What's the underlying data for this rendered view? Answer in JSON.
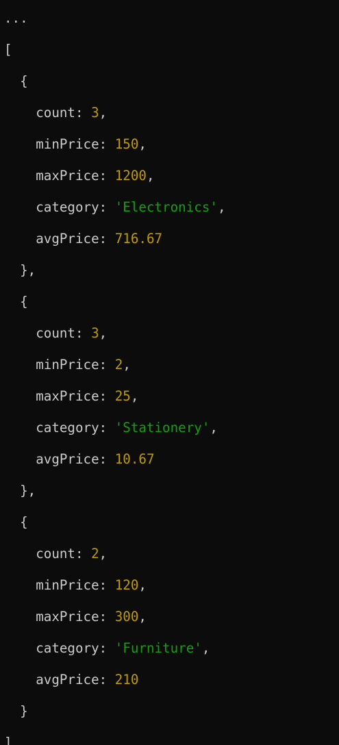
{
  "terminal": {
    "ellipsis": "...",
    "open_bracket": "[",
    "close_bracket": "]"
  },
  "records": [
    {
      "count": "3",
      "minPrice": "150",
      "maxPrice": "1200",
      "category": "'Electronics'",
      "avgPrice": "716.67"
    },
    {
      "count": "3",
      "minPrice": "2",
      "maxPrice": "25",
      "category": "'Stationery'",
      "avgPrice": "10.67"
    },
    {
      "count": "2",
      "minPrice": "120",
      "maxPrice": "300",
      "category": "'Furniture'",
      "avgPrice": "210"
    }
  ],
  "labels": {
    "count": "count",
    "minPrice": "minPrice",
    "maxPrice": "maxPrice",
    "category": "category",
    "avgPrice": "avgPrice"
  },
  "colors": {
    "background": "#0c0c0c",
    "text": "#cccccc",
    "number": "#c19c00",
    "string": "#13a10e"
  }
}
